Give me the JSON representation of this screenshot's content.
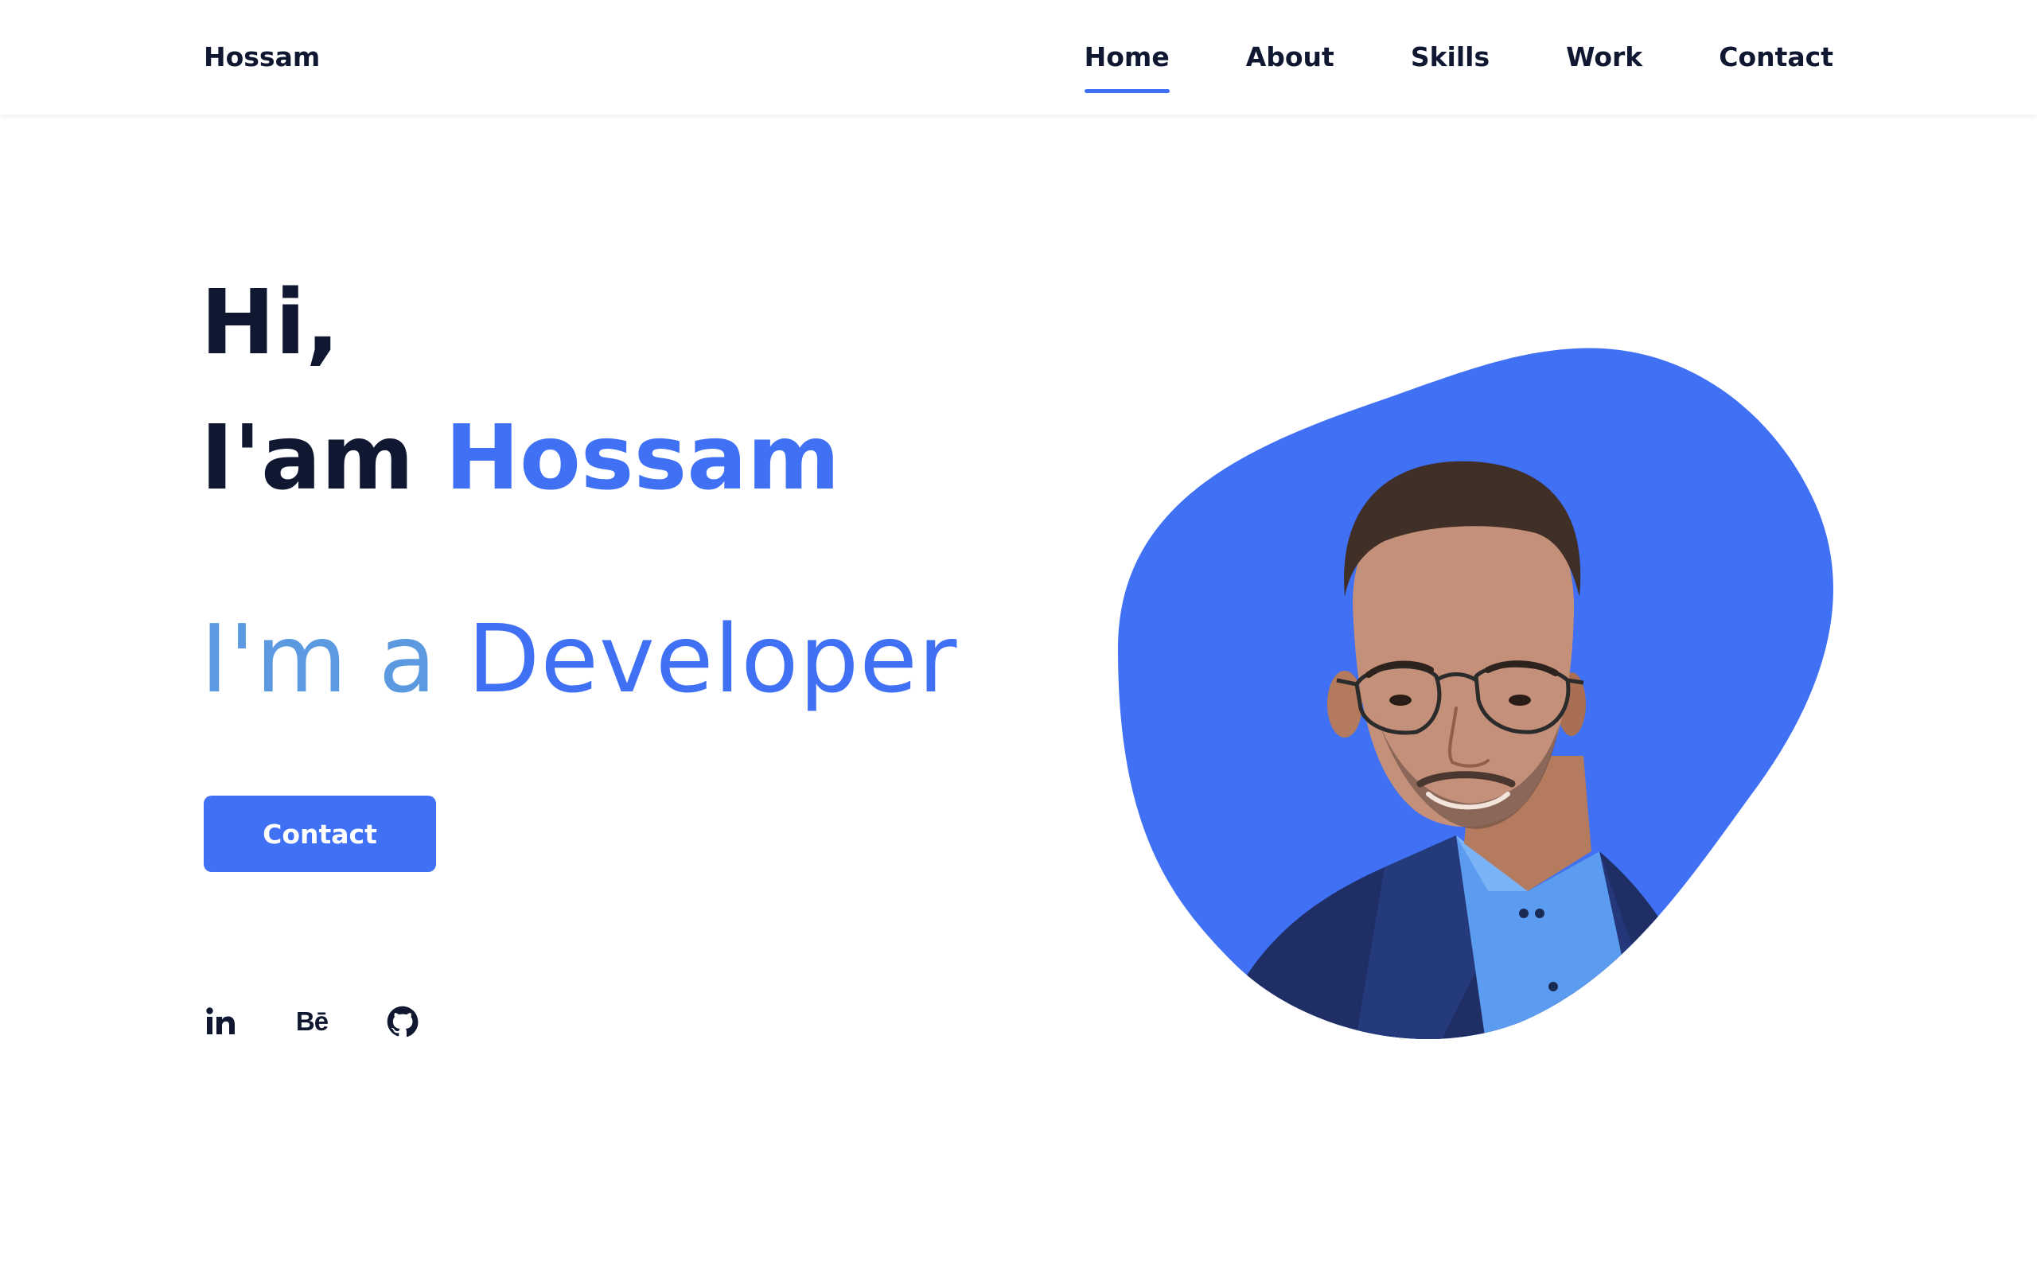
{
  "header": {
    "logo": "Hossam",
    "nav": [
      {
        "label": "Home",
        "active": true
      },
      {
        "label": "About",
        "active": false
      },
      {
        "label": "Skills",
        "active": false
      },
      {
        "label": "Work",
        "active": false
      },
      {
        "label": "Contact",
        "active": false
      }
    ]
  },
  "hero": {
    "greeting": "Hi,",
    "intro": "I'am",
    "name": "Hossam",
    "role_prefix": "I'm a",
    "role": "Developer",
    "button_label": "Contact"
  },
  "socials": [
    {
      "icon": "linkedin-icon",
      "glyph": "in"
    },
    {
      "icon": "behance-icon",
      "glyph": "Bē"
    },
    {
      "icon": "github-icon",
      "glyph": ""
    }
  ],
  "colors": {
    "accent": "#4070f4",
    "text": "#0f1731",
    "role_prefix": "#5b9ae0"
  }
}
